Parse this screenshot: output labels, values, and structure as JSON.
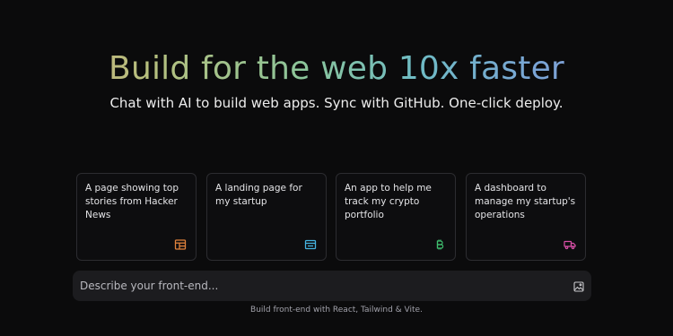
{
  "hero": {
    "title": "Build for the web 10x faster",
    "subtitle": "Chat with AI to build web apps. Sync with GitHub. One-click deploy."
  },
  "suggestions": [
    {
      "text": "A page showing top stories from Hacker News",
      "icon": "layout-icon",
      "icon_color": "#e0823c"
    },
    {
      "text": "A landing page for my startup",
      "icon": "browser-window-icon",
      "icon_color": "#45b3e0"
    },
    {
      "text": "An app to help me track my crypto portfolio",
      "icon": "bitcoin-icon",
      "icon_color": "#3fbf6f"
    },
    {
      "text": "A dashboard to manage my startup's operations",
      "icon": "truck-icon",
      "icon_color": "#d94fa8"
    }
  ],
  "prompt": {
    "placeholder": "Describe your front-end...",
    "value": ""
  },
  "footer": {
    "note": "Build front-end with React, Tailwind & Vite."
  },
  "colors": {
    "background": "#0b0b0c",
    "card_border": "#2c2c30",
    "input_background": "#1c1c1f"
  }
}
